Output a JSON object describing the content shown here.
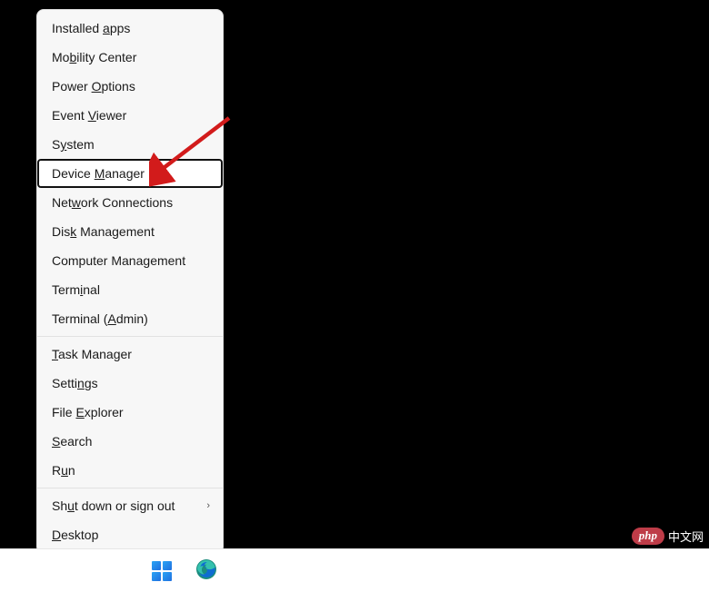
{
  "menu": {
    "groups": [
      [
        {
          "id": "installed-apps",
          "pre": "Installed ",
          "u": "a",
          "post": "pps"
        },
        {
          "id": "mobility-center",
          "pre": "Mo",
          "u": "b",
          "post": "ility Center"
        },
        {
          "id": "power-options",
          "pre": "Power ",
          "u": "O",
          "post": "ptions"
        },
        {
          "id": "event-viewer",
          "pre": "Event ",
          "u": "V",
          "post": "iewer"
        },
        {
          "id": "system",
          "pre": "S",
          "u": "y",
          "post": "stem"
        },
        {
          "id": "device-manager",
          "pre": "Device ",
          "u": "M",
          "post": "anager",
          "focused": true
        },
        {
          "id": "network-connections",
          "pre": "Net",
          "u": "w",
          "post": "ork Connections"
        },
        {
          "id": "disk-management",
          "pre": "Dis",
          "u": "k",
          "post": " Management"
        },
        {
          "id": "computer-management",
          "pre": "Computer Mana",
          "u": "g",
          "post": "ement"
        },
        {
          "id": "terminal",
          "pre": "Term",
          "u": "i",
          "post": "nal"
        },
        {
          "id": "terminal-admin",
          "pre": "Terminal (",
          "u": "A",
          "post": "dmin)"
        }
      ],
      [
        {
          "id": "task-manager",
          "pre": "",
          "u": "T",
          "post": "ask Manager"
        },
        {
          "id": "settings",
          "pre": "Setti",
          "u": "n",
          "post": "gs"
        },
        {
          "id": "file-explorer",
          "pre": "File ",
          "u": "E",
          "post": "xplorer"
        },
        {
          "id": "search",
          "pre": "",
          "u": "S",
          "post": "earch"
        },
        {
          "id": "run",
          "pre": "R",
          "u": "u",
          "post": "n"
        }
      ],
      [
        {
          "id": "shutdown",
          "pre": "Sh",
          "u": "u",
          "post": "t down or sign out",
          "submenu": true
        },
        {
          "id": "desktop",
          "pre": "",
          "u": "D",
          "post": "esktop"
        }
      ]
    ]
  },
  "watermark": {
    "brand": "php",
    "text": "中文网"
  },
  "colors": {
    "arrow": "#d21b1b"
  }
}
